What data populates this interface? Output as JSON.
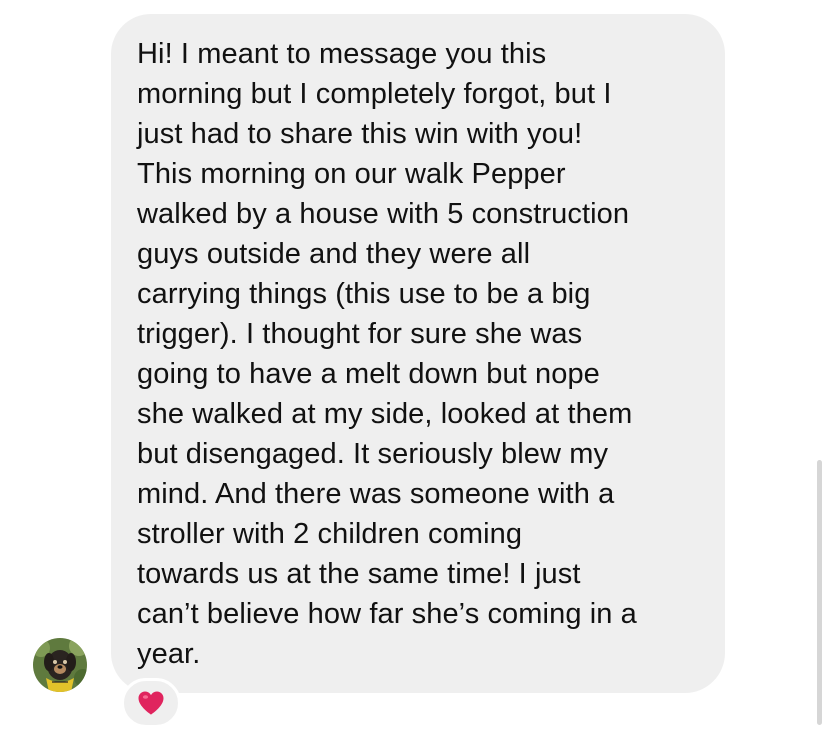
{
  "message": {
    "text": "Hi! I meant to message you this\nmorning but I completely forgot, but I\njust had to share this win with you!\nThis morning on our walk Pepper\nwalked by a house with 5 construction\nguys outside and they were all\ncarrying things (this use to be a big\ntrigger). I thought for sure she was\ngoing to have a melt down but nope\nshe walked at my side, looked at them\nbut disengaged. It seriously blew my\nmind. And there was someone with a\nstroller with 2 children coming\ntowards us at the same time! I just\ncan’t believe how far she’s coming in a\nyear."
  },
  "sender": {
    "avatar_icon": "dog-avatar"
  },
  "reaction": {
    "icon": "heart-icon",
    "color": "#e0245e"
  },
  "colors": {
    "bubble": "#efefef",
    "text": "#111111",
    "background": "#ffffff"
  }
}
